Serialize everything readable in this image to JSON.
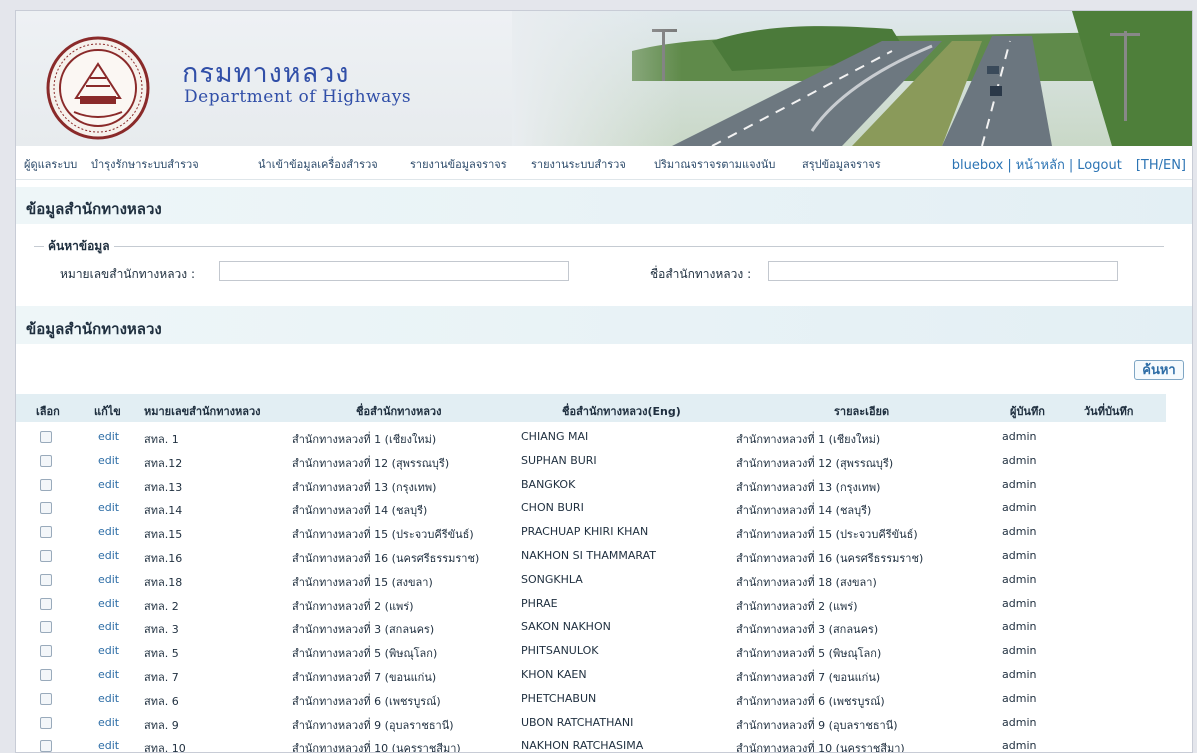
{
  "header": {
    "brand_th": "กรมทางหลวง",
    "brand_en": "Department of Highways"
  },
  "nav": {
    "items": [
      "ผู้ดูแลระบบ",
      "บำรุงรักษาระบบสำรวจ",
      "นำเข้าข้อมูลเครื่องสำรวจ",
      "รายงานข้อมูลจราจร",
      "รายงานระบบสำรวจ",
      "ปริมาณจราจรตามแจงนับ",
      "สรุปข้อมูลจราจร"
    ],
    "user": "bluebox",
    "home": "หน้าหลัก",
    "logout": "Logout",
    "lang": "[TH/EN]"
  },
  "search_section": {
    "title": "ข้อมูลสำนักทางหลวง",
    "legend": "ค้นหาข้อมูล",
    "field_code_label": "หมายเลขสำนักทางหลวง :",
    "field_code_value": "",
    "field_name_label": "ชื่อสำนักทางหลวง :",
    "field_name_value": ""
  },
  "list_section": {
    "title": "ข้อมูลสำนักทางหลวง",
    "search_button": "ค้นหา"
  },
  "table": {
    "columns": [
      "เลือก",
      "แก้ไข",
      "หมายเลขสำนักทางหลวง",
      "ชื่อสำนักทางหลวง",
      "ชื่อสำนักทางหลวง(Eng)",
      "รายละเอียด",
      "ผู้บันทึก",
      "วันที่บันทึก"
    ],
    "rows": [
      {
        "edit": "edit",
        "code": "สทล. 1",
        "name": "สำนักทางหลวงที่ 1 (เชียงใหม่)",
        "name_en": "CHIANG MAI",
        "detail": "สำนักทางหลวงที่ 1 (เชียงใหม่)",
        "user": "admin",
        "date": ""
      },
      {
        "edit": "edit",
        "code": "สทล.12",
        "name": "สำนักทางหลวงที่ 12 (สุพรรณบุรี)",
        "name_en": "SUPHAN BURI",
        "detail": "สำนักทางหลวงที่ 12 (สุพรรณบุรี)",
        "user": "admin",
        "date": ""
      },
      {
        "edit": "edit",
        "code": "สทล.13",
        "name": "สำนักทางหลวงที่ 13 (กรุงเทพ)",
        "name_en": "BANGKOK",
        "detail": "สำนักทางหลวงที่ 13 (กรุงเทพ)",
        "user": "admin",
        "date": ""
      },
      {
        "edit": "edit",
        "code": "สทล.14",
        "name": "สำนักทางหลวงที่ 14 (ชลบุรี)",
        "name_en": "CHON BURI",
        "detail": "สำนักทางหลวงที่ 14 (ชลบุรี)",
        "user": "admin",
        "date": ""
      },
      {
        "edit": "edit",
        "code": "สทล.15",
        "name": "สำนักทางหลวงที่ 15 (ประจวบคีรีขันธ์)",
        "name_en": "PRACHUAP KHIRI KHAN",
        "detail": "สำนักทางหลวงที่ 15 (ประจวบคีรีขันธ์)",
        "user": "admin",
        "date": ""
      },
      {
        "edit": "edit",
        "code": "สทล.16",
        "name": "สำนักทางหลวงที่ 16 (นครศรีธรรมราช)",
        "name_en": "NAKHON SI THAMMARAT",
        "detail": "สำนักทางหลวงที่ 16 (นครศรีธรรมราช)",
        "user": "admin",
        "date": ""
      },
      {
        "edit": "edit",
        "code": "สทล.18",
        "name": "สำนักทางหลวงที่ 15 (สงขลา)",
        "name_en": "SONGKHLA",
        "detail": "สำนักทางหลวงที่ 18 (สงขลา)",
        "user": "admin",
        "date": ""
      },
      {
        "edit": "edit",
        "code": "สทล. 2",
        "name": "สำนักทางหลวงที่ 2 (แพร่)",
        "name_en": "PHRAE",
        "detail": "สำนักทางหลวงที่ 2 (แพร่)",
        "user": "admin",
        "date": ""
      },
      {
        "edit": "edit",
        "code": "สทล. 3",
        "name": "สำนักทางหลวงที่ 3 (สกลนคร)",
        "name_en": "SAKON NAKHON",
        "detail": "สำนักทางหลวงที่ 3 (สกลนคร)",
        "user": "admin",
        "date": ""
      },
      {
        "edit": "edit",
        "code": "สทล. 5",
        "name": "สำนักทางหลวงที่ 5 (พิษณุโลก)",
        "name_en": "PHITSANULOK",
        "detail": "สำนักทางหลวงที่ 5 (พิษณุโลก)",
        "user": "admin",
        "date": ""
      },
      {
        "edit": "edit",
        "code": "สทล. 7",
        "name": "สำนักทางหลวงที่ 7 (ขอนแก่น)",
        "name_en": "KHON KAEN",
        "detail": "สำนักทางหลวงที่ 7 (ขอนแก่น)",
        "user": "admin",
        "date": ""
      },
      {
        "edit": "edit",
        "code": "สทล. 6",
        "name": "สำนักทางหลวงที่ 6 (เพชรบูรณ์)",
        "name_en": "PHETCHABUN",
        "detail": "สำนักทางหลวงที่ 6 (เพชรบูรณ์)",
        "user": "admin",
        "date": ""
      },
      {
        "edit": "edit",
        "code": "สทล. 9",
        "name": "สำนักทางหลวงที่ 9 (อุบลราชธานี)",
        "name_en": "UBON RATCHATHANI",
        "detail": "สำนักทางหลวงที่ 9 (อุบลราชธานี)",
        "user": "admin",
        "date": ""
      },
      {
        "edit": "edit",
        "code": "สทล. 10",
        "name": "สำนักทางหลวงที่ 10 (นครราชสีมา)",
        "name_en": "NAKHON RATCHASIMA",
        "detail": "สำนักทางหลวงที่ 10 (นครราชสีมา)",
        "user": "admin",
        "date": ""
      }
    ]
  },
  "colors": {
    "brand": "#314fa8",
    "link": "#2d6da6",
    "section_bg": "#e3eff4",
    "header_row_bg": "#e2eef3"
  }
}
